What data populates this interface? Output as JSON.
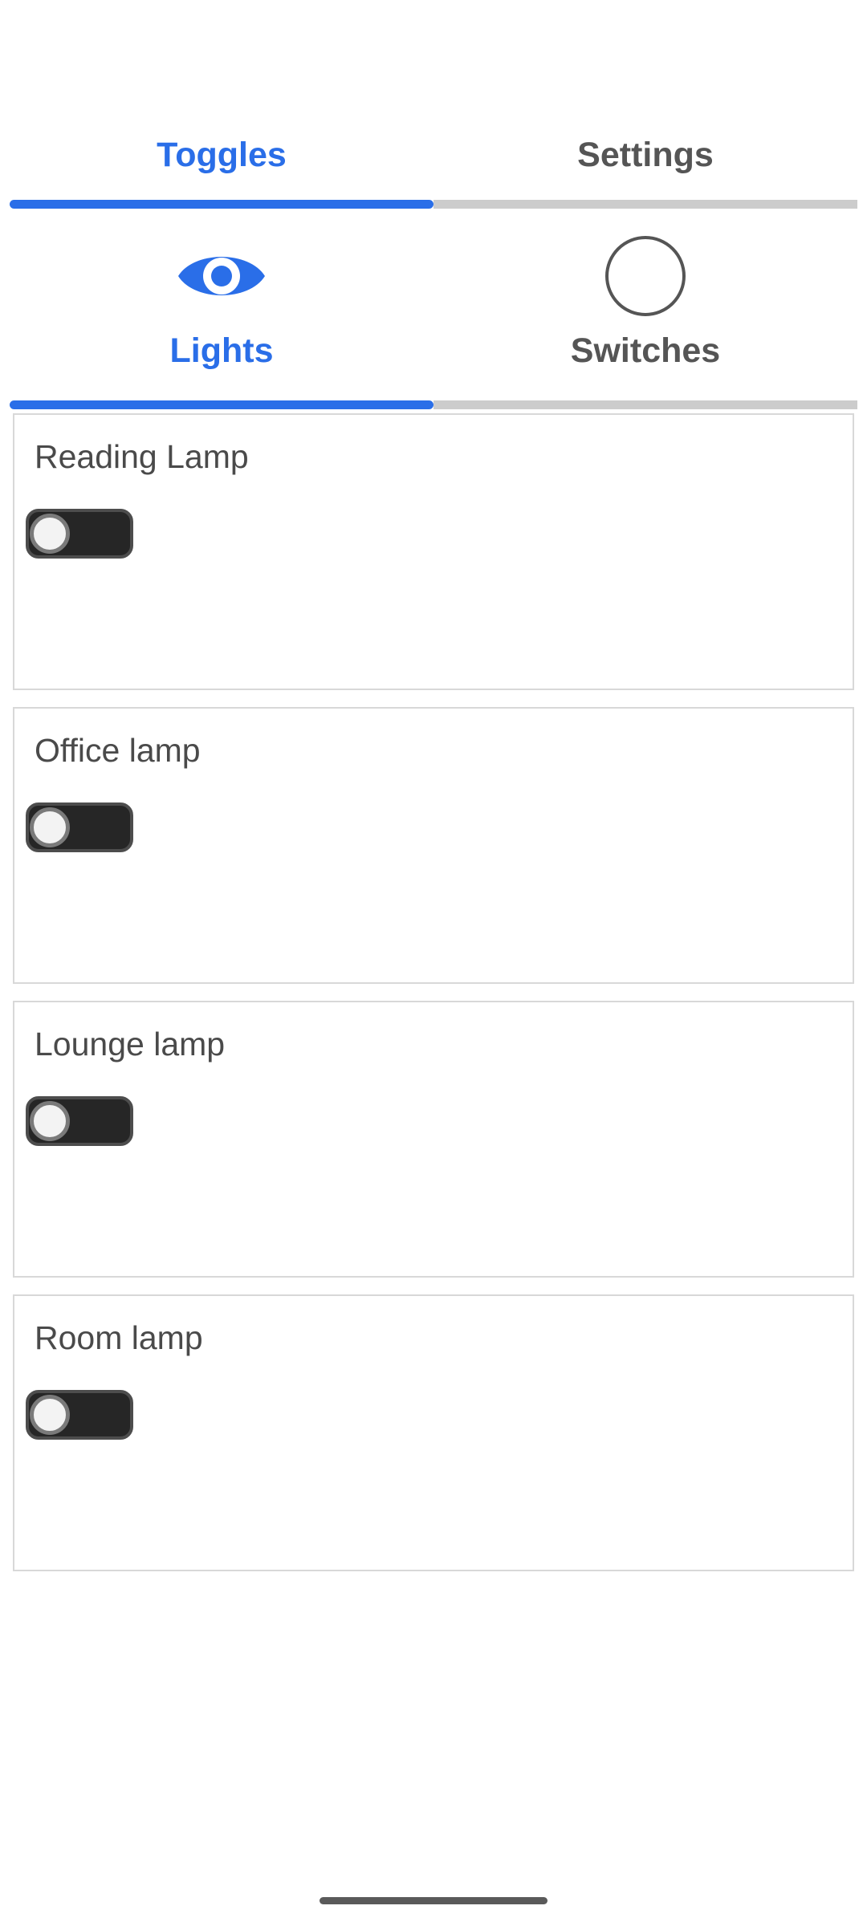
{
  "top_tabs": [
    {
      "label": "Toggles",
      "active": true
    },
    {
      "label": "Settings",
      "active": false
    }
  ],
  "sub_tabs": [
    {
      "label": "Lights",
      "icon": "eye-icon",
      "active": true
    },
    {
      "label": "Switches",
      "icon": "circle-icon",
      "active": false
    }
  ],
  "cards": [
    {
      "title": "Reading Lamp",
      "toggle_on": false
    },
    {
      "title": "Office lamp",
      "toggle_on": false
    },
    {
      "title": "Lounge lamp",
      "toggle_on": false
    },
    {
      "title": "Room lamp",
      "toggle_on": false
    }
  ],
  "colors": {
    "accent": "#2a6ee8",
    "inactive_text": "#555555",
    "inactive_bar": "#cccccc",
    "toggle_track": "#262626",
    "card_border": "#d8d8d8"
  }
}
